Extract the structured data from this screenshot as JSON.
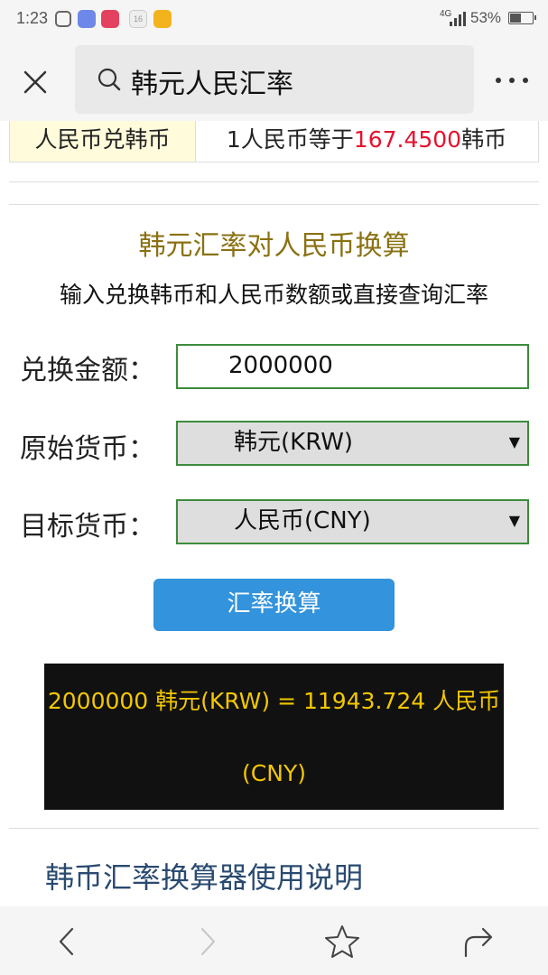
{
  "status_bar": {
    "time": "1:23",
    "calendar_day": "16",
    "network": "4G",
    "battery": "53%",
    "battery_level": 0.53
  },
  "search": {
    "query": "韩元人民汇率"
  },
  "rate_table": {
    "label": "人民币兑韩币",
    "value_prefix": "1人民币等于",
    "value_number": "167.4500",
    "value_suffix": "韩币"
  },
  "converter": {
    "title": "韩元汇率对人民币换算",
    "subtitle": "输入兑换韩币和人民币数额或直接查询汇率",
    "amount_label": "兑换金额：",
    "amount_value": "2000000",
    "source_label": "原始货币：",
    "source_value": "韩元(KRW)",
    "target_label": "目标货币：",
    "target_value": "人民币(CNY)",
    "button_label": "汇率换算",
    "result_line1": "2000000 韩元(KRW) = 11943.724 人民币",
    "result_line2": "(CNY)"
  },
  "section": {
    "title": "韩币汇率换算器使用说明"
  },
  "colors": {
    "accent_red": "#e8112d",
    "title_gold": "#8a7112",
    "button_blue": "#3393dc",
    "result_yellow": "#f4c700",
    "field_border_green": "#3c8c3c"
  }
}
